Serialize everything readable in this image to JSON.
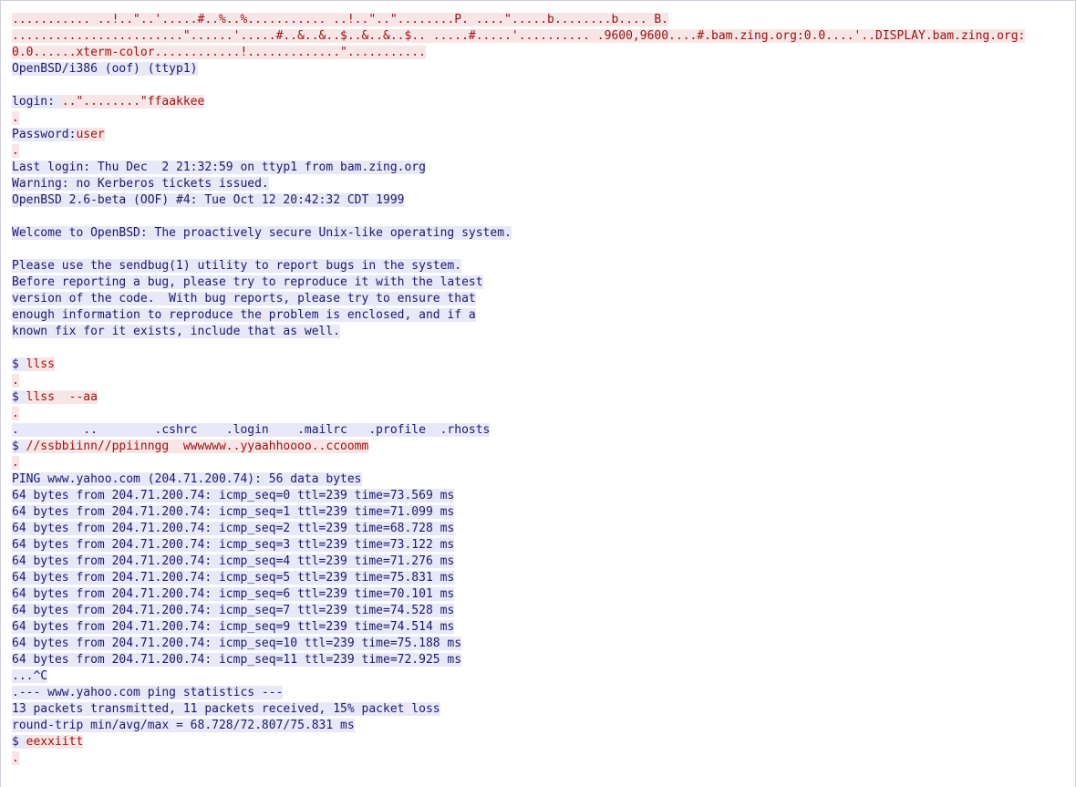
{
  "colors": {
    "background": "#ffffff",
    "server_output_text": "#1a1a6e",
    "server_output_bg": "#e8e8f8",
    "client_input_text": "#a01010",
    "client_input_bg": "#f8e6e6"
  },
  "lines": [
    [
      {
        "t": "........... ..!..\"..'.....#..%..%........... ..!..\"..\"........P. ....\".....b........b.... B.",
        "k": "in"
      }
    ],
    [
      {
        "t": "........................\"......'.....#..&..&..$..&..&..$.. .....#.....'.......... .9600,9600....#.bam.zing.org:0.0....'..DISPLAY.bam.zing.org:",
        "k": "in"
      }
    ],
    [
      {
        "t": "0.0......xterm-color............!.............\"...........",
        "k": "in"
      }
    ],
    [
      {
        "t": "OpenBSD/i386 (oof) (ttyp1)",
        "k": "out"
      }
    ],
    [],
    [
      {
        "t": "login: ",
        "k": "out"
      },
      {
        "t": "..\"........\"ffaakkee",
        "k": "in"
      }
    ],
    [
      {
        "t": ".",
        "k": "in"
      }
    ],
    [
      {
        "t": "Password:",
        "k": "out"
      },
      {
        "t": "user",
        "k": "in"
      }
    ],
    [
      {
        "t": ".",
        "k": "in"
      }
    ],
    [
      {
        "t": "Last login: Thu Dec  2 21:32:59 on ttyp1 from bam.zing.org",
        "k": "out"
      }
    ],
    [
      {
        "t": "Warning: no Kerberos tickets issued.",
        "k": "out"
      }
    ],
    [
      {
        "t": "OpenBSD 2.6-beta (OOF) #4: Tue Oct 12 20:42:32 CDT 1999",
        "k": "out"
      }
    ],
    [],
    [
      {
        "t": "Welcome to OpenBSD: The proactively secure Unix-like operating system.",
        "k": "out"
      }
    ],
    [],
    [
      {
        "t": "Please use the sendbug(1) utility to report bugs in the system.",
        "k": "out"
      }
    ],
    [
      {
        "t": "Before reporting a bug, please try to reproduce it with the latest",
        "k": "out"
      }
    ],
    [
      {
        "t": "version of the code.  With bug reports, please try to ensure that",
        "k": "out"
      }
    ],
    [
      {
        "t": "enough information to reproduce the problem is enclosed, and if a",
        "k": "out"
      }
    ],
    [
      {
        "t": "known fix for it exists, include that as well.",
        "k": "out"
      }
    ],
    [],
    [
      {
        "t": "$ ",
        "k": "out"
      },
      {
        "t": "llss",
        "k": "in"
      }
    ],
    [
      {
        "t": ".",
        "k": "in"
      }
    ],
    [
      {
        "t": "$ ",
        "k": "out"
      },
      {
        "t": "llss  --aa",
        "k": "in"
      }
    ],
    [
      {
        "t": ".",
        "k": "in"
      }
    ],
    [
      {
        "t": ".         ..        .cshrc    .login    .mailrc   .profile  .rhosts",
        "k": "out"
      }
    ],
    [
      {
        "t": "$ ",
        "k": "out"
      },
      {
        "t": "//ssbbiinn//ppiinngg  wwwwww..yyaahhoooo..ccoomm",
        "k": "in"
      }
    ],
    [
      {
        "t": ".",
        "k": "in"
      }
    ],
    [
      {
        "t": "PING www.yahoo.com (204.71.200.74): 56 data bytes",
        "k": "out"
      }
    ],
    [
      {
        "t": "64 bytes from 204.71.200.74: icmp_seq=0 ttl=239 time=73.569 ms",
        "k": "out"
      }
    ],
    [
      {
        "t": "64 bytes from 204.71.200.74: icmp_seq=1 ttl=239 time=71.099 ms",
        "k": "out"
      }
    ],
    [
      {
        "t": "64 bytes from 204.71.200.74: icmp_seq=2 ttl=239 time=68.728 ms",
        "k": "out"
      }
    ],
    [
      {
        "t": "64 bytes from 204.71.200.74: icmp_seq=3 ttl=239 time=73.122 ms",
        "k": "out"
      }
    ],
    [
      {
        "t": "64 bytes from 204.71.200.74: icmp_seq=4 ttl=239 time=71.276 ms",
        "k": "out"
      }
    ],
    [
      {
        "t": "64 bytes from 204.71.200.74: icmp_seq=5 ttl=239 time=75.831 ms",
        "k": "out"
      }
    ],
    [
      {
        "t": "64 bytes from 204.71.200.74: icmp_seq=6 ttl=239 time=70.101 ms",
        "k": "out"
      }
    ],
    [
      {
        "t": "64 bytes from 204.71.200.74: icmp_seq=7 ttl=239 time=74.528 ms",
        "k": "out"
      }
    ],
    [
      {
        "t": "64 bytes from 204.71.200.74: icmp_seq=9 ttl=239 time=74.514 ms",
        "k": "out"
      }
    ],
    [
      {
        "t": "64 bytes from 204.71.200.74: icmp_seq=10 ttl=239 time=75.188 ms",
        "k": "out"
      }
    ],
    [
      {
        "t": "64 bytes from 204.71.200.74: icmp_seq=11 ttl=239 time=72.925 ms",
        "k": "out"
      }
    ],
    [
      {
        "t": "...^C",
        "k": "out"
      }
    ],
    [
      {
        "t": ".--- www.yahoo.com ping statistics ---",
        "k": "out"
      }
    ],
    [
      {
        "t": "13 packets transmitted, 11 packets received, 15% packet loss",
        "k": "out"
      }
    ],
    [
      {
        "t": "round-trip min/avg/max = 68.728/72.807/75.831 ms",
        "k": "out"
      }
    ],
    [
      {
        "t": "$ ",
        "k": "out"
      },
      {
        "t": "eexxiitt",
        "k": "in"
      }
    ],
    [
      {
        "t": ".",
        "k": "in"
      }
    ]
  ]
}
